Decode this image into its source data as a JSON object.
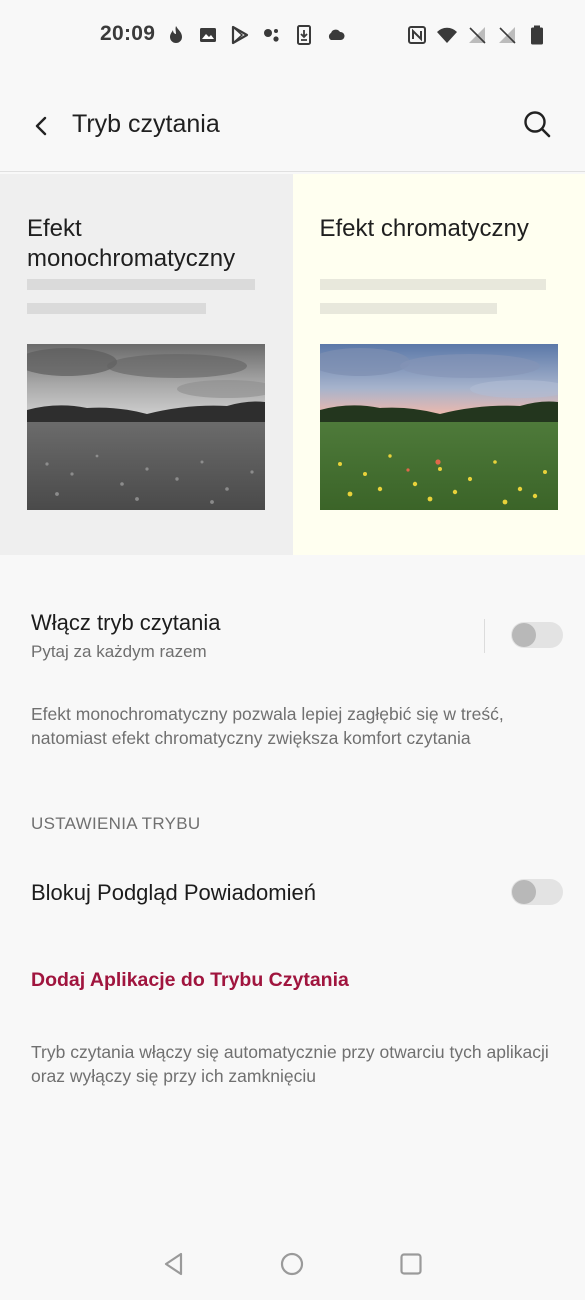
{
  "status_bar": {
    "time": "20:09",
    "left_icons": [
      "fire-icon",
      "image-icon",
      "play-store-icon",
      "assistant-icon",
      "download-icon",
      "cloud-icon"
    ],
    "right_icons": [
      "nfc-icon",
      "wifi-icon",
      "no-signal-icon",
      "no-signal-icon",
      "battery-icon"
    ]
  },
  "app_bar": {
    "title": "Tryb czytania",
    "back_icon": "back-arrow-icon",
    "search_icon": "search-icon"
  },
  "effects": {
    "mono": {
      "title": "Efekt monochromatyczny"
    },
    "chroma": {
      "title": "Efekt chromatyczny"
    }
  },
  "reading_mode": {
    "title": "Włącz tryb czytania",
    "subtitle": "Pytaj za każdym razem",
    "enabled": false
  },
  "description": "Efekt monochromatyczny pozwala lepiej zagłębić się w treść, natomiast efekt chromatyczny zwiększa komfort czytania",
  "mode_settings": {
    "header": "USTAWIENIA TRYBU",
    "block_notifications": {
      "title": "Blokuj Podgląd Powiadomień",
      "enabled": false
    },
    "add_apps_link": "Dodaj Aplikacje do Trybu Czytania",
    "footer_desc": "Tryb czytania włączy się automatycznie przy otwarciu tych aplikacji oraz wyłączy się przy ich zamknięciu"
  },
  "colors": {
    "accent": "#a0153e",
    "mono_bg": "#efefef",
    "chroma_bg": "#fffff0"
  },
  "nav_bar": [
    "back-triangle-icon",
    "home-circle-icon",
    "recents-square-icon"
  ]
}
